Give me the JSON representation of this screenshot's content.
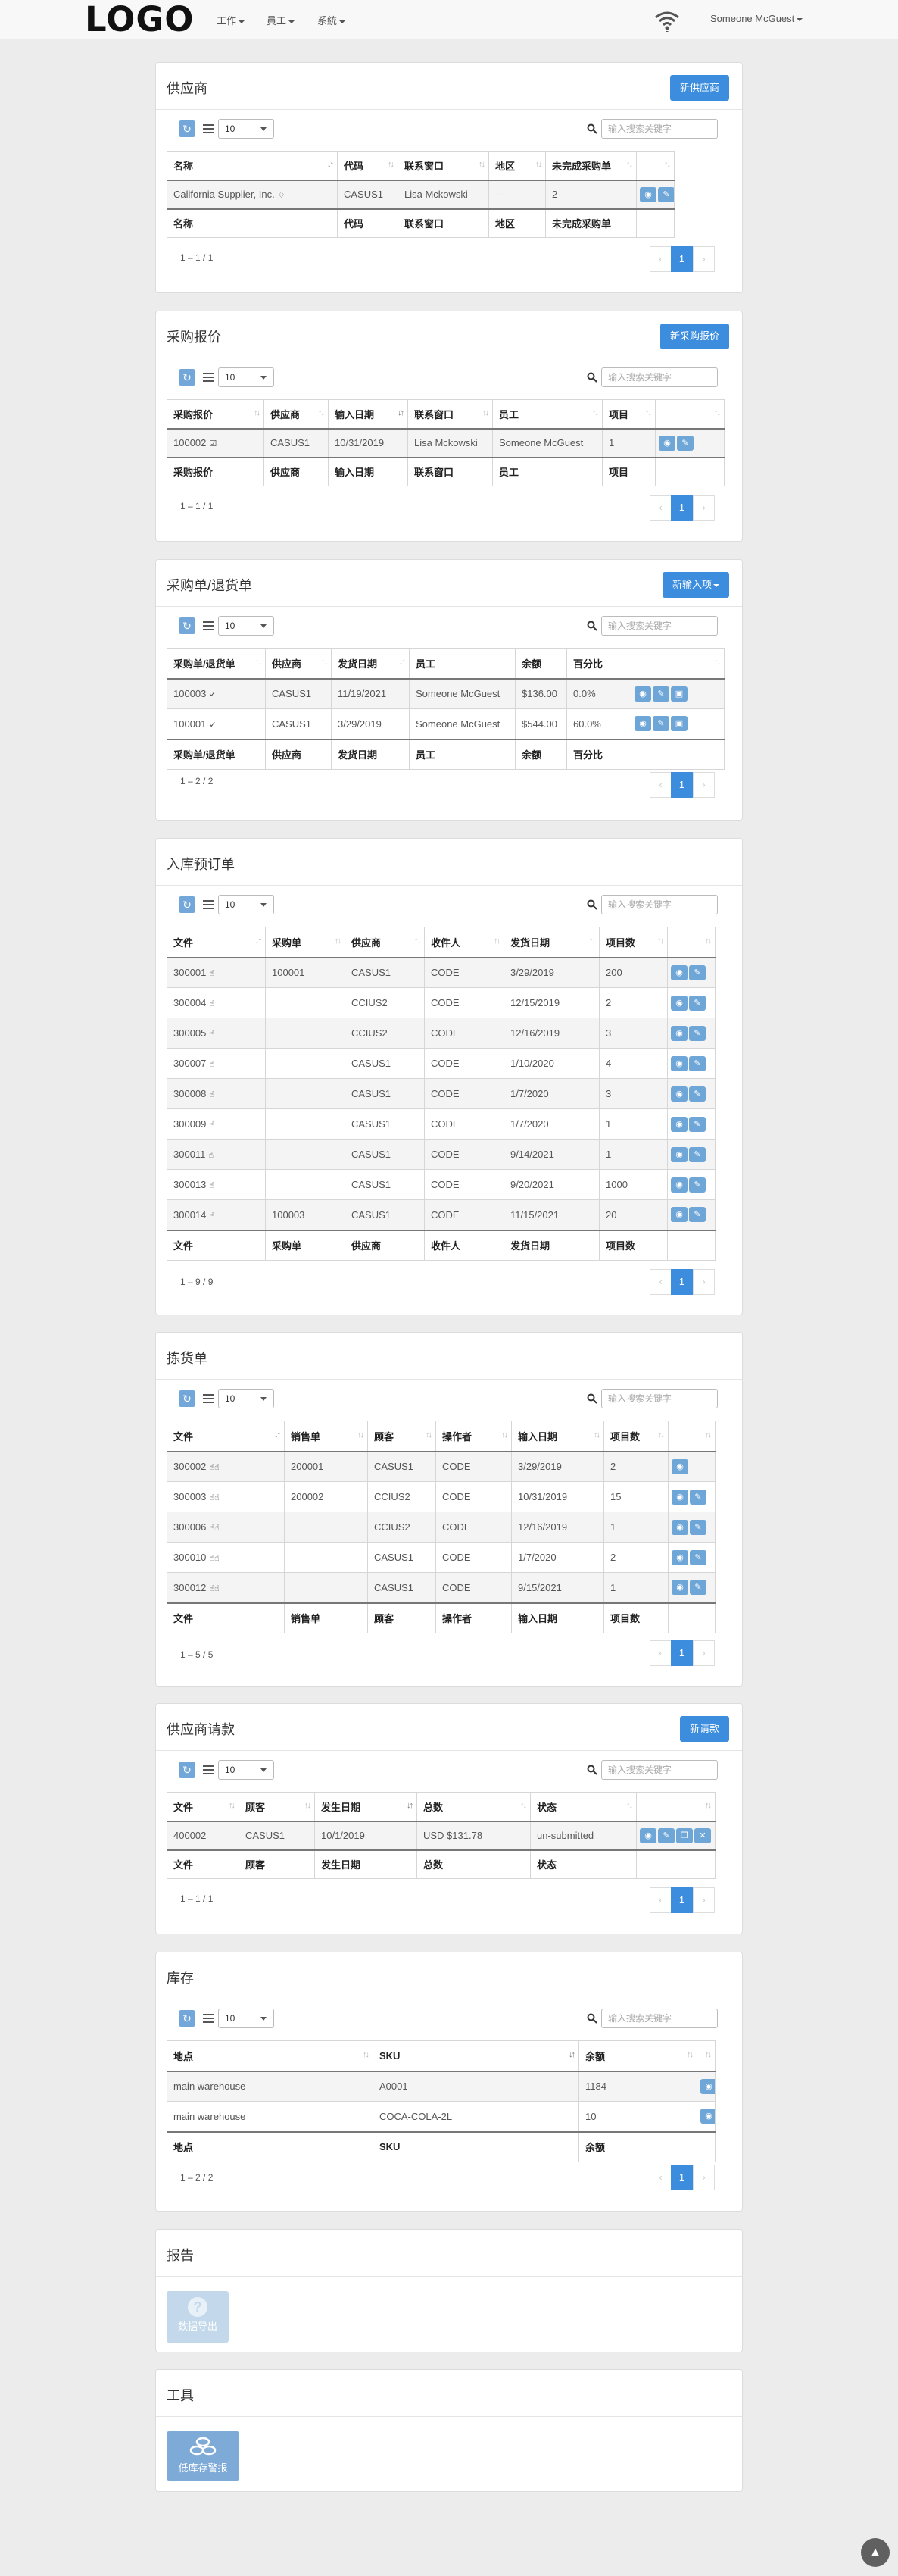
{
  "header": {
    "logo": "LOGO",
    "nav": [
      "工作",
      "員工",
      "系統"
    ],
    "user": "Someone McGuest"
  },
  "search_placeholder": "输入搜索关键字",
  "page_size": "10",
  "suppliers": {
    "title": "供应商",
    "button": "新供应商",
    "columns": [
      "名称",
      "代码",
      "联系窗口",
      "地区",
      "未完成采购单"
    ],
    "rows": [
      [
        "California Supplier, Inc.",
        "CASUS1",
        "Lisa Mckowski",
        "---",
        "2"
      ]
    ],
    "info": "1 – 1 / 1",
    "page": "1"
  },
  "quotes": {
    "title": "采购报价",
    "button": "新采购报价",
    "columns": [
      "采购报价",
      "供应商",
      "输入日期",
      "联系窗口",
      "员工",
      "项目"
    ],
    "rows": [
      [
        "100002",
        "CASUS1",
        "10/31/2019",
        "Lisa Mckowski",
        "Someone McGuest",
        "1"
      ]
    ],
    "info": "1 – 1 / 1",
    "page": "1"
  },
  "orders": {
    "title": "采购单/退货单",
    "button": "新输入项",
    "columns": [
      "采购单/退货单",
      "供应商",
      "发货日期",
      "员工",
      "余额",
      "百分比"
    ],
    "rows": [
      [
        "100003",
        "CASUS1",
        "11/19/2021",
        "Someone McGuest",
        "$136.00",
        "0.0%"
      ],
      [
        "100001",
        "CASUS1",
        "3/29/2019",
        "Someone McGuest",
        "$544.00",
        "60.0%"
      ]
    ],
    "info": "1 – 2 / 2",
    "page": "1"
  },
  "inbound": {
    "title": "入库预订单",
    "columns": [
      "文件",
      "采购单",
      "供应商",
      "收件人",
      "发货日期",
      "项目数"
    ],
    "rows": [
      [
        "300001",
        "100001",
        "CASUS1",
        "CODE",
        "3/29/2019",
        "200"
      ],
      [
        "300004",
        "",
        "CCIUS2",
        "CODE",
        "12/15/2019",
        "2"
      ],
      [
        "300005",
        "",
        "CCIUS2",
        "CODE",
        "12/16/2019",
        "3"
      ],
      [
        "300007",
        "",
        "CASUS1",
        "CODE",
        "1/10/2020",
        "4"
      ],
      [
        "300008",
        "",
        "CASUS1",
        "CODE",
        "1/7/2020",
        "3"
      ],
      [
        "300009",
        "",
        "CASUS1",
        "CODE",
        "1/7/2020",
        "1"
      ],
      [
        "300011",
        "",
        "CASUS1",
        "CODE",
        "9/14/2021",
        "1"
      ],
      [
        "300013",
        "",
        "CASUS1",
        "CODE",
        "9/20/2021",
        "1000"
      ],
      [
        "300014",
        "100003",
        "CASUS1",
        "CODE",
        "11/15/2021",
        "20"
      ]
    ],
    "info": "1 – 9 / 9",
    "page": "1"
  },
  "picking": {
    "title": "拣货单",
    "columns": [
      "文件",
      "销售单",
      "顾客",
      "操作者",
      "输入日期",
      "项目数"
    ],
    "rows": [
      [
        "300002",
        "200001",
        "CASUS1",
        "CODE",
        "3/29/2019",
        "2"
      ],
      [
        "300003",
        "200002",
        "CCIUS2",
        "CODE",
        "10/31/2019",
        "15"
      ],
      [
        "300006",
        "",
        "CCIUS2",
        "CODE",
        "12/16/2019",
        "1"
      ],
      [
        "300010",
        "",
        "CASUS1",
        "CODE",
        "1/7/2020",
        "2"
      ],
      [
        "300012",
        "",
        "CASUS1",
        "CODE",
        "9/15/2021",
        "1"
      ]
    ],
    "info": "1 – 5 / 5",
    "page": "1"
  },
  "requests": {
    "title": "供应商请款",
    "button": "新请款",
    "columns": [
      "文件",
      "顾客",
      "发生日期",
      "总数",
      "状态"
    ],
    "rows": [
      [
        "400002",
        "CASUS1",
        "10/1/2019",
        "USD $131.78",
        "un-submitted"
      ]
    ],
    "info": "1 – 1 / 1",
    "page": "1"
  },
  "inventory": {
    "title": "库存",
    "columns": [
      "地点",
      "SKU",
      "余额"
    ],
    "rows": [
      [
        "main warehouse",
        "A0001",
        "1184"
      ],
      [
        "main warehouse",
        "COCA-COLA-2L",
        "10"
      ]
    ],
    "info": "1 – 2 / 2",
    "page": "1"
  },
  "reports": {
    "title": "报告",
    "tile": "数据导出"
  },
  "tools": {
    "title": "工具",
    "tile": "低库存警报"
  }
}
